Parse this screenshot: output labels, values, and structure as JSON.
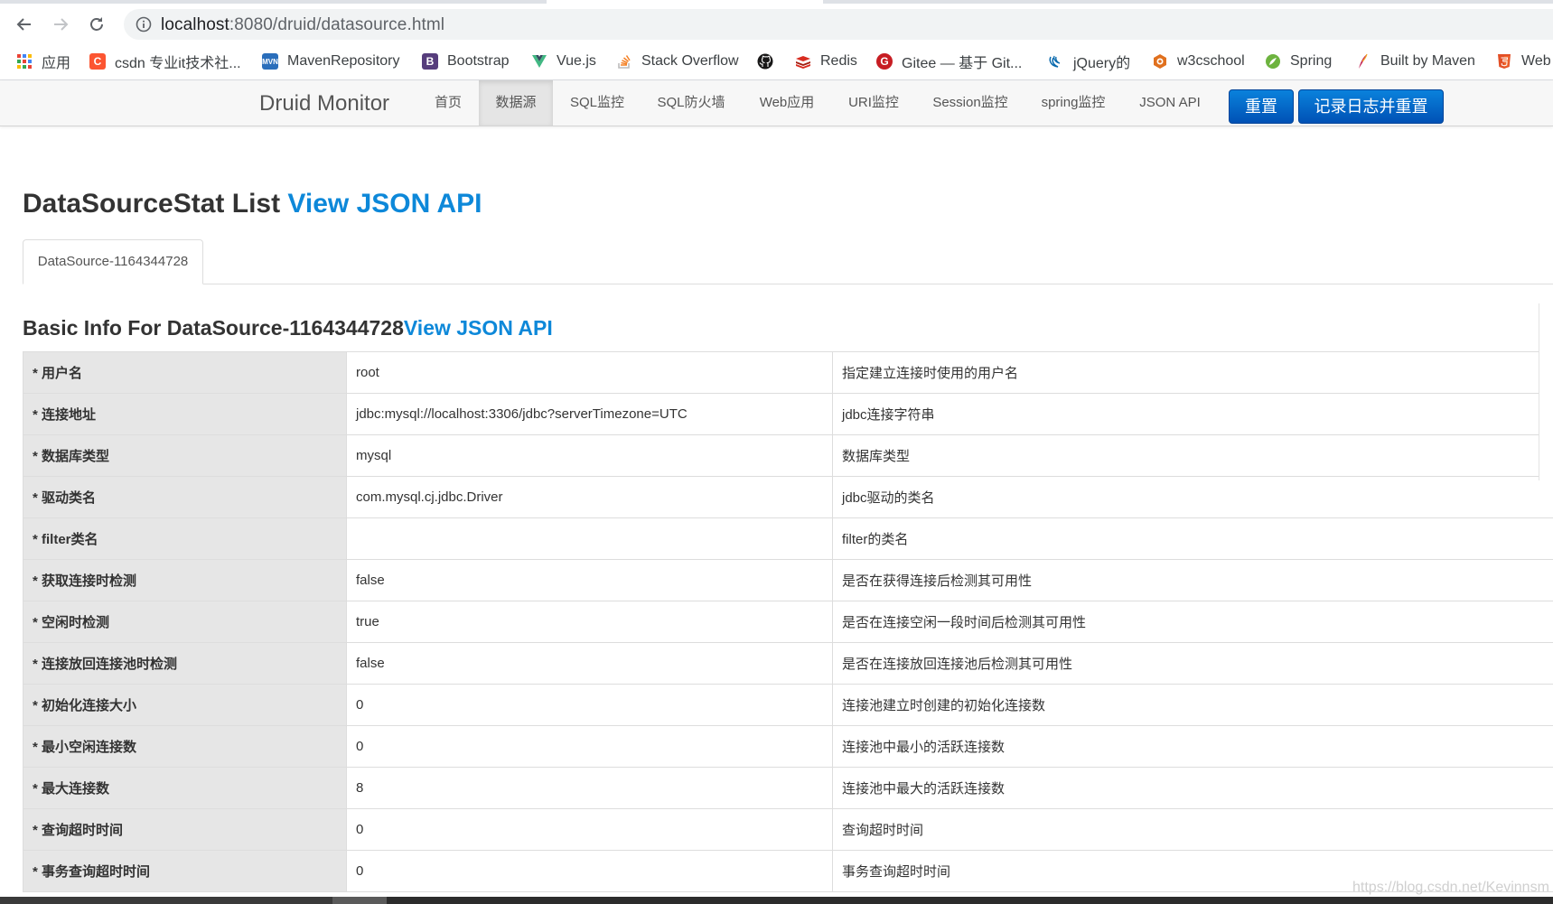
{
  "browser": {
    "url_host": "localhost",
    "url_path": ":8080/druid/datasource.html",
    "bookmarks": [
      {
        "label": "应用",
        "icon": "apps-grid-icon",
        "color": "#ea4335"
      },
      {
        "label": "csdn 专业it技术社...",
        "icon": "csdn-icon",
        "color": "#fc5531"
      },
      {
        "label": "MavenRepository",
        "icon": "mvn-icon",
        "color": "#2a6ebb"
      },
      {
        "label": "Bootstrap",
        "icon": "bootstrap-icon",
        "color": "#563d7c"
      },
      {
        "label": "Vue.js",
        "icon": "vue-icon",
        "color": "#41b883"
      },
      {
        "label": "Stack Overflow",
        "icon": "stackoverflow-icon",
        "color": "#f48024"
      },
      {
        "label": "",
        "icon": "github-icon",
        "color": "#181717"
      },
      {
        "label": "Redis",
        "icon": "redis-icon",
        "color": "#d82c20"
      },
      {
        "label": "Gitee — 基于 Git...",
        "icon": "gitee-icon",
        "color": "#c71d23"
      },
      {
        "label": "jQuery的",
        "icon": "jquery-icon",
        "color": "#0769ad"
      },
      {
        "label": "w3cschool",
        "icon": "w3cschool-icon",
        "color": "#e0701e"
      },
      {
        "label": "Spring",
        "icon": "spring-icon",
        "color": "#6db33f"
      },
      {
        "label": "Built by Maven",
        "icon": "maven-feather-icon",
        "color": "#c42a5a"
      },
      {
        "label": "Web",
        "icon": "html5-icon",
        "color": "#e34f26"
      }
    ]
  },
  "navbar": {
    "brand": "Druid Monitor",
    "items": [
      "首页",
      "数据源",
      "SQL监控",
      "SQL防火墙",
      "Web应用",
      "URI监控",
      "Session监控",
      "spring监控",
      "JSON API"
    ],
    "active_index": 1,
    "reset_button": "重置",
    "log_reset_button": "记录日志并重置"
  },
  "page": {
    "title": "DataSourceStat List ",
    "title_link": "View JSON API",
    "datasource_tab": "DataSource-1164344728",
    "section_title": "Basic Info For DataSource-1164344728",
    "section_link": "View JSON API"
  },
  "rows": [
    {
      "key": "* 用户名",
      "value": "root",
      "desc": "指定建立连接时使用的用户名"
    },
    {
      "key": "* 连接地址",
      "value": "jdbc:mysql://localhost:3306/jdbc?serverTimezone=UTC",
      "desc": "jdbc连接字符串"
    },
    {
      "key": "* 数据库类型",
      "value": "mysql",
      "desc": "数据库类型"
    },
    {
      "key": "* 驱动类名",
      "value": "com.mysql.cj.jdbc.Driver",
      "desc": "jdbc驱动的类名"
    },
    {
      "key": "* filter类名",
      "value": "",
      "desc": "filter的类名"
    },
    {
      "key": "* 获取连接时检测",
      "value": "false",
      "desc": "是否在获得连接后检测其可用性"
    },
    {
      "key": "* 空闲时检测",
      "value": "true",
      "desc": "是否在连接空闲一段时间后检测其可用性"
    },
    {
      "key": "* 连接放回连接池时检测",
      "value": "false",
      "desc": "是否在连接放回连接池后检测其可用性"
    },
    {
      "key": "* 初始化连接大小",
      "value": "0",
      "desc": "连接池建立时创建的初始化连接数"
    },
    {
      "key": "* 最小空闲连接数",
      "value": "0",
      "desc": "连接池中最小的活跃连接数"
    },
    {
      "key": "* 最大连接数",
      "value": "8",
      "desc": "连接池中最大的活跃连接数"
    },
    {
      "key": "* 查询超时时间",
      "value": "0",
      "desc": "查询超时时间"
    },
    {
      "key": "* 事务查询超时时间",
      "value": "0",
      "desc": "事务查询超时时间"
    }
  ],
  "watermark": "https://blog.csdn.net/Kevinnsm"
}
